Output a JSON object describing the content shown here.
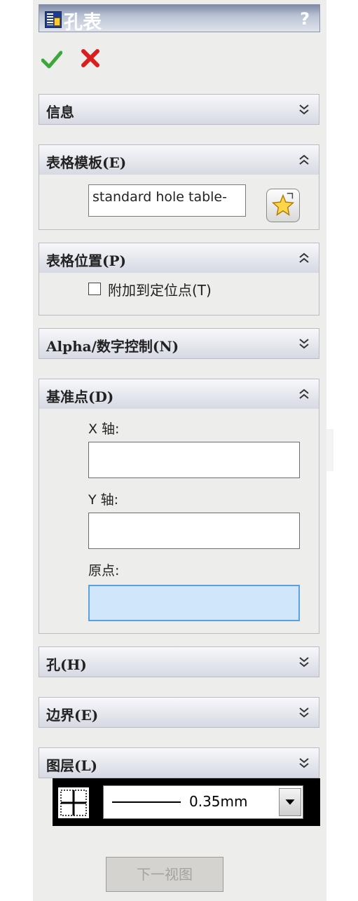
{
  "window": {
    "title": "孔表",
    "help": "?"
  },
  "sections": {
    "info": {
      "label": "信息"
    },
    "template": {
      "label": "表格模板(E)",
      "value": "standard hole table-"
    },
    "position": {
      "label": "表格位置(P)",
      "checkbox_label": "附加到定位点(T)",
      "checked": false
    },
    "alpha": {
      "label": "Alpha/数字控制(N)"
    },
    "datum": {
      "label": "基准点(D)",
      "x_label": "X 轴:",
      "x_value": "",
      "y_label": "Y 轴:",
      "y_value": "",
      "origin_label": "原点:",
      "origin_value": ""
    },
    "holes": {
      "label": "孔(H)"
    },
    "border": {
      "label": "边界(E)"
    },
    "layer": {
      "label": "图层(L)",
      "line_weight": "0.35mm"
    }
  },
  "buttons": {
    "next_view": "下一视图"
  },
  "colors": {
    "accept": "#3aa83a",
    "cancel": "#d91e1e",
    "active_field": "#cfe6fb"
  }
}
